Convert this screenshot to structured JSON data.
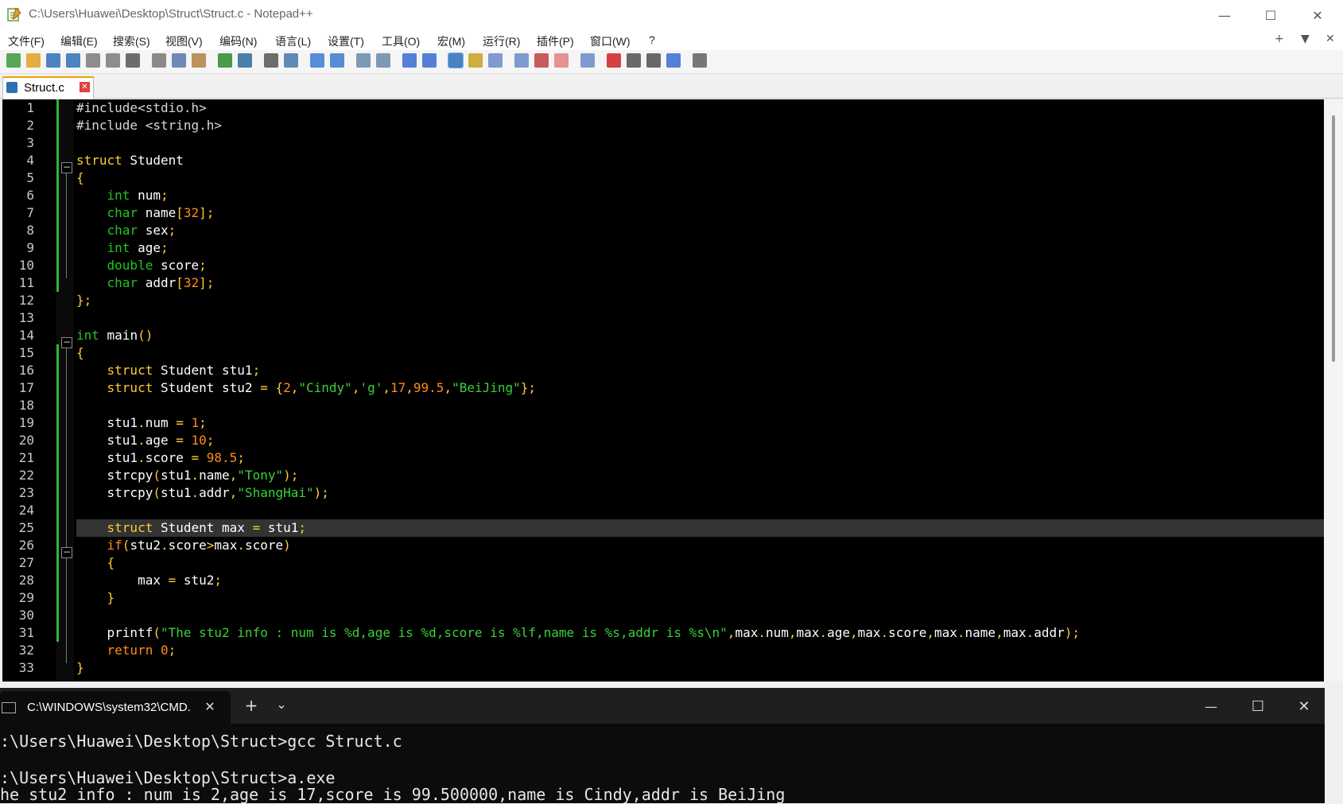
{
  "window": {
    "title": "C:\\Users\\Huawei\\Desktop\\Struct\\Struct.c - Notepad++",
    "minimize": "—",
    "maximize": "☐",
    "close": "✕"
  },
  "menu": {
    "items": [
      "文件(F)",
      "编辑(E)",
      "搜索(S)",
      "视图(V)",
      "编码(N)",
      "语言(L)",
      "设置(T)",
      "工具(O)",
      "宏(M)",
      "运行(R)",
      "插件(P)",
      "窗口(W)",
      "?"
    ],
    "right": [
      "+",
      "▼",
      "✕"
    ]
  },
  "toolbar": {
    "icons": [
      "new-file-icon",
      "open-file-icon",
      "save-icon",
      "save-all-icon",
      "close-icon",
      "close-all-icon",
      "print-icon",
      "cut-icon",
      "copy-icon",
      "paste-icon",
      "undo-icon",
      "redo-icon",
      "find-icon",
      "replace-icon",
      "zoom-in-icon",
      "zoom-out-icon",
      "sync-vertical-icon",
      "sync-horizontal-icon",
      "word-wrap-icon",
      "show-all-chars-icon",
      "indent-guide-icon",
      "udl-icon",
      "doc-map-icon",
      "function-list-icon",
      "folder-workspace-icon",
      "folder-icon",
      "monitor-icon",
      "record-macro-icon",
      "stop-macro-icon",
      "play-macro-icon",
      "run-macro-multiple-icon",
      "save-macro-icon"
    ],
    "colors": [
      "#3a9a3a",
      "#e0a020",
      "#2e6fb7",
      "#2e6fb7",
      "#7a7a7a",
      "#7a7a7a",
      "#555555",
      "#777777",
      "#5577aa",
      "#b08040",
      "#2a8a2a",
      "#2a6a9a",
      "#555555",
      "#4477aa",
      "#3a7ad0",
      "#3a7ad0",
      "#6688aa",
      "#6688aa",
      "#3a6ad0",
      "#3a6ad0",
      "#2e6fb7",
      "#c8a020",
      "#6a8ac8",
      "#6a8ac8",
      "#c04040",
      "#e08080",
      "#6a8ac8",
      "#d02020",
      "#505050",
      "#505050",
      "#3a6ad0",
      "#606060"
    ],
    "selected_index": 20
  },
  "tab": {
    "label": "Struct.c",
    "close": "✕"
  },
  "editor": {
    "current_line": 25,
    "lines": [
      [
        {
          "c": "pp",
          "t": "#include<stdio.h>"
        }
      ],
      [
        {
          "c": "pp",
          "t": "#include <string.h>"
        }
      ],
      [],
      [
        {
          "c": "k",
          "t": "struct"
        },
        {
          "c": "",
          "t": " Student"
        }
      ],
      [
        {
          "c": "o",
          "t": "{"
        }
      ],
      [
        {
          "c": "",
          "t": "    "
        },
        {
          "c": "t",
          "t": "int"
        },
        {
          "c": "",
          "t": " num"
        },
        {
          "c": "o",
          "t": ";"
        }
      ],
      [
        {
          "c": "",
          "t": "    "
        },
        {
          "c": "t",
          "t": "char"
        },
        {
          "c": "",
          "t": " name"
        },
        {
          "c": "o",
          "t": "["
        },
        {
          "c": "n",
          "t": "32"
        },
        {
          "c": "o",
          "t": "];"
        }
      ],
      [
        {
          "c": "",
          "t": "    "
        },
        {
          "c": "t",
          "t": "char"
        },
        {
          "c": "",
          "t": " sex"
        },
        {
          "c": "o",
          "t": ";"
        }
      ],
      [
        {
          "c": "",
          "t": "    "
        },
        {
          "c": "t",
          "t": "int"
        },
        {
          "c": "",
          "t": " age"
        },
        {
          "c": "o",
          "t": ";"
        }
      ],
      [
        {
          "c": "",
          "t": "    "
        },
        {
          "c": "t",
          "t": "double"
        },
        {
          "c": "",
          "t": " score"
        },
        {
          "c": "o",
          "t": ";"
        }
      ],
      [
        {
          "c": "",
          "t": "    "
        },
        {
          "c": "t",
          "t": "char"
        },
        {
          "c": "",
          "t": " addr"
        },
        {
          "c": "o",
          "t": "["
        },
        {
          "c": "n",
          "t": "32"
        },
        {
          "c": "o",
          "t": "];"
        }
      ],
      [
        {
          "c": "o",
          "t": "};"
        }
      ],
      [],
      [
        {
          "c": "t",
          "t": "int"
        },
        {
          "c": "",
          "t": " main"
        },
        {
          "c": "o",
          "t": "()"
        }
      ],
      [
        {
          "c": "o",
          "t": "{"
        }
      ],
      [
        {
          "c": "",
          "t": "    "
        },
        {
          "c": "k",
          "t": "struct"
        },
        {
          "c": "",
          "t": " Student stu1"
        },
        {
          "c": "o",
          "t": ";"
        }
      ],
      [
        {
          "c": "",
          "t": "    "
        },
        {
          "c": "k",
          "t": "struct"
        },
        {
          "c": "",
          "t": " Student stu2 "
        },
        {
          "c": "o",
          "t": "= {"
        },
        {
          "c": "n",
          "t": "2"
        },
        {
          "c": "o",
          "t": ","
        },
        {
          "c": "s",
          "t": "\"Cindy\""
        },
        {
          "c": "o",
          "t": ","
        },
        {
          "c": "s",
          "t": "'g'"
        },
        {
          "c": "o",
          "t": ","
        },
        {
          "c": "n",
          "t": "17"
        },
        {
          "c": "o",
          "t": ","
        },
        {
          "c": "n",
          "t": "99.5"
        },
        {
          "c": "o",
          "t": ","
        },
        {
          "c": "s",
          "t": "\"BeiJing\""
        },
        {
          "c": "o",
          "t": "};"
        }
      ],
      [],
      [
        {
          "c": "",
          "t": "    stu1"
        },
        {
          "c": "o",
          "t": "."
        },
        {
          "c": "",
          "t": "num "
        },
        {
          "c": "o",
          "t": "="
        },
        {
          "c": "",
          "t": " "
        },
        {
          "c": "n",
          "t": "1"
        },
        {
          "c": "o",
          "t": ";"
        }
      ],
      [
        {
          "c": "",
          "t": "    stu1"
        },
        {
          "c": "o",
          "t": "."
        },
        {
          "c": "",
          "t": "age "
        },
        {
          "c": "o",
          "t": "="
        },
        {
          "c": "",
          "t": " "
        },
        {
          "c": "n",
          "t": "10"
        },
        {
          "c": "o",
          "t": ";"
        }
      ],
      [
        {
          "c": "",
          "t": "    stu1"
        },
        {
          "c": "o",
          "t": "."
        },
        {
          "c": "",
          "t": "score "
        },
        {
          "c": "o",
          "t": "="
        },
        {
          "c": "",
          "t": " "
        },
        {
          "c": "n",
          "t": "98.5"
        },
        {
          "c": "o",
          "t": ";"
        }
      ],
      [
        {
          "c": "",
          "t": "    strcpy"
        },
        {
          "c": "o",
          "t": "("
        },
        {
          "c": "",
          "t": "stu1"
        },
        {
          "c": "o",
          "t": "."
        },
        {
          "c": "",
          "t": "name"
        },
        {
          "c": "o",
          "t": ","
        },
        {
          "c": "s",
          "t": "\"Tony\""
        },
        {
          "c": "o",
          "t": ");"
        }
      ],
      [
        {
          "c": "",
          "t": "    strcpy"
        },
        {
          "c": "o",
          "t": "("
        },
        {
          "c": "",
          "t": "stu1"
        },
        {
          "c": "o",
          "t": "."
        },
        {
          "c": "",
          "t": "addr"
        },
        {
          "c": "o",
          "t": ","
        },
        {
          "c": "s",
          "t": "\"ShangHai\""
        },
        {
          "c": "o",
          "t": ");"
        }
      ],
      [],
      [
        {
          "c": "",
          "t": "    "
        },
        {
          "c": "k",
          "t": "struct"
        },
        {
          "c": "",
          "t": " Student max "
        },
        {
          "c": "o",
          "t": "="
        },
        {
          "c": "",
          "t": " stu1"
        },
        {
          "c": "o",
          "t": ";"
        }
      ],
      [
        {
          "c": "",
          "t": "    "
        },
        {
          "c": "kb",
          "t": "if"
        },
        {
          "c": "o",
          "t": "("
        },
        {
          "c": "",
          "t": "stu2"
        },
        {
          "c": "o",
          "t": "."
        },
        {
          "c": "",
          "t": "score"
        },
        {
          "c": "o",
          "t": ">"
        },
        {
          "c": "",
          "t": "max"
        },
        {
          "c": "o",
          "t": "."
        },
        {
          "c": "",
          "t": "score"
        },
        {
          "c": "o",
          "t": ")"
        }
      ],
      [
        {
          "c": "",
          "t": "    "
        },
        {
          "c": "o",
          "t": "{"
        }
      ],
      [
        {
          "c": "",
          "t": "        max "
        },
        {
          "c": "o",
          "t": "="
        },
        {
          "c": "",
          "t": " stu2"
        },
        {
          "c": "o",
          "t": ";"
        }
      ],
      [
        {
          "c": "",
          "t": "    "
        },
        {
          "c": "o",
          "t": "}"
        }
      ],
      [],
      [
        {
          "c": "",
          "t": "    printf"
        },
        {
          "c": "o",
          "t": "("
        },
        {
          "c": "s",
          "t": "\"The stu2 info : num is %d,age is %d,score is %lf,name is %s,addr is %s\\n\""
        },
        {
          "c": "o",
          "t": ","
        },
        {
          "c": "",
          "t": "max"
        },
        {
          "c": "o",
          "t": "."
        },
        {
          "c": "",
          "t": "num"
        },
        {
          "c": "o",
          "t": ","
        },
        {
          "c": "",
          "t": "max"
        },
        {
          "c": "o",
          "t": "."
        },
        {
          "c": "",
          "t": "age"
        },
        {
          "c": "o",
          "t": ","
        },
        {
          "c": "",
          "t": "max"
        },
        {
          "c": "o",
          "t": "."
        },
        {
          "c": "",
          "t": "score"
        },
        {
          "c": "o",
          "t": ","
        },
        {
          "c": "",
          "t": "max"
        },
        {
          "c": "o",
          "t": "."
        },
        {
          "c": "",
          "t": "name"
        },
        {
          "c": "o",
          "t": ","
        },
        {
          "c": "",
          "t": "max"
        },
        {
          "c": "o",
          "t": "."
        },
        {
          "c": "",
          "t": "addr"
        },
        {
          "c": "o",
          "t": ");"
        }
      ],
      [
        {
          "c": "",
          "t": "    "
        },
        {
          "c": "kb",
          "t": "return"
        },
        {
          "c": "",
          "t": " "
        },
        {
          "c": "n",
          "t": "0"
        },
        {
          "c": "o",
          "t": ";"
        }
      ],
      [
        {
          "c": "o",
          "t": "}"
        }
      ]
    ]
  },
  "cmd": {
    "tab_title": "C:\\WINDOWS\\system32\\CMD.",
    "tab_close": "✕",
    "new_tab": "+",
    "dropdown": "⌄",
    "minimize": "—",
    "maximize": "☐",
    "close": "✕",
    "lines": [
      ":\\Users\\Huawei\\Desktop\\Struct>gcc Struct.c",
      "",
      ":\\Users\\Huawei\\Desktop\\Struct>a.exe",
      "he stu2 info : num is 2,age is 17,score is 99.500000,name is Cindy,addr is BeiJing"
    ]
  }
}
